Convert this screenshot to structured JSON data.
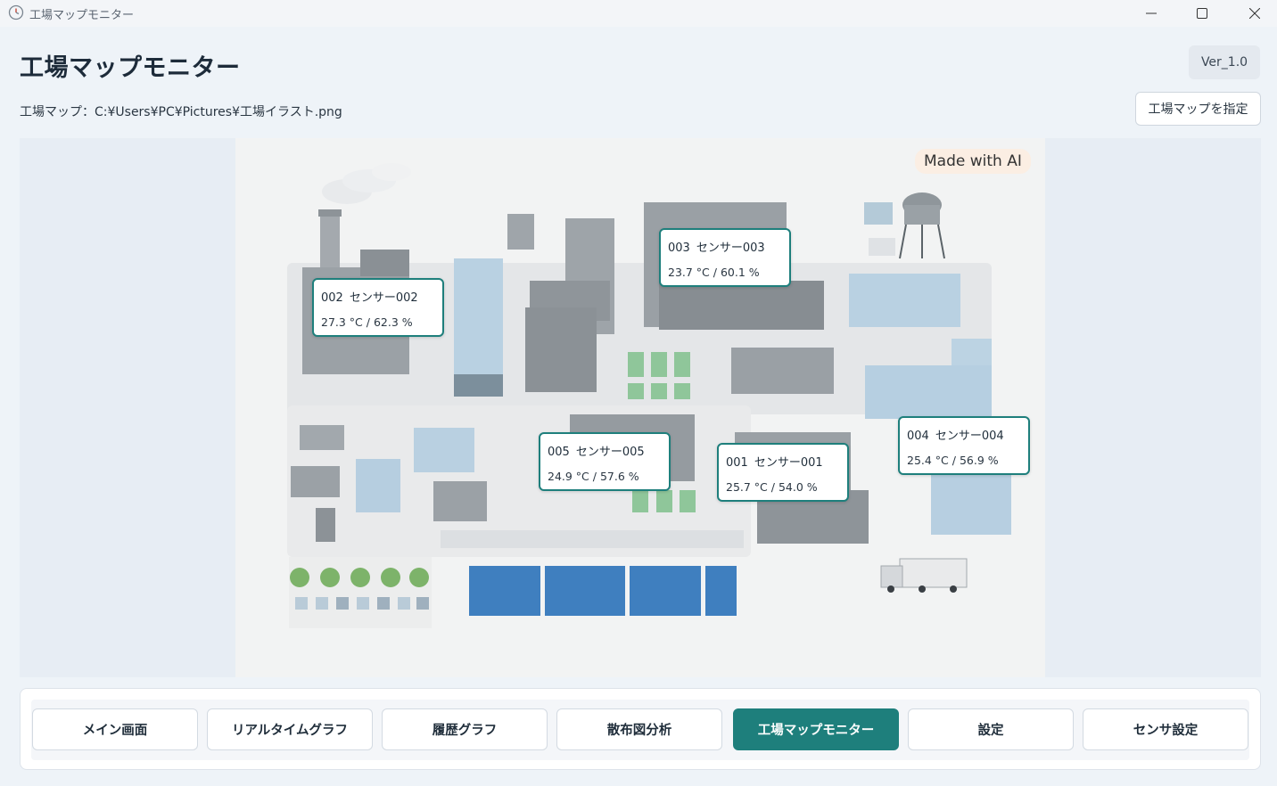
{
  "window": {
    "title": "工場マップモニター"
  },
  "header": {
    "title": "工場マップモニター",
    "version": "Ver_1.0",
    "map_path_label": "工場マップ：",
    "map_path": "C:¥Users¥PC¥Pictures¥工場イラスト.png",
    "choose_map_label": "工場マップを指定"
  },
  "map": {
    "ai_badge": "Made with AI"
  },
  "sensors": [
    {
      "id": "002",
      "name": "センサー002",
      "temperature": "27.3",
      "humidity": "62.3",
      "reading": "27.3 °C / 62.3 %"
    },
    {
      "id": "003",
      "name": "センサー003",
      "temperature": "23.7",
      "humidity": "60.1",
      "reading": "23.7 °C / 60.1 %"
    },
    {
      "id": "005",
      "name": "センサー005",
      "temperature": "24.9",
      "humidity": "57.6",
      "reading": "24.9 °C / 57.6 %"
    },
    {
      "id": "001",
      "name": "センサー001",
      "temperature": "25.7",
      "humidity": "54.0",
      "reading": "25.7 °C / 54.0 %"
    },
    {
      "id": "004",
      "name": "センサー004",
      "temperature": "25.4",
      "humidity": "56.9",
      "reading": "25.4 °C / 56.9 %"
    }
  ],
  "nav": {
    "items": [
      {
        "label": "メイン画面",
        "active": false
      },
      {
        "label": "リアルタイムグラフ",
        "active": false
      },
      {
        "label": "履歴グラフ",
        "active": false
      },
      {
        "label": "散布図分析",
        "active": false
      },
      {
        "label": "工場マップモニター",
        "active": true
      },
      {
        "label": "設定",
        "active": false
      },
      {
        "label": "センサ設定",
        "active": false
      }
    ]
  },
  "colors": {
    "accent": "#1e7f7c",
    "background": "#eef3f8"
  },
  "icons": {
    "app": "clock-icon",
    "minimize": "minimize-icon",
    "maximize": "maximize-icon",
    "close": "close-icon"
  }
}
